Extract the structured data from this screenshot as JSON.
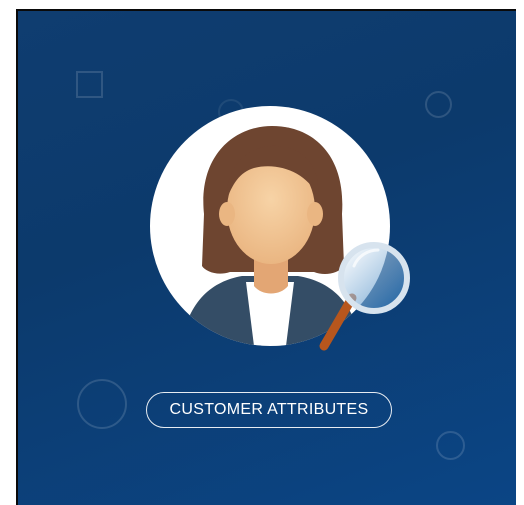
{
  "card": {
    "button_label": "CUSTOMER ATTRIBUTES"
  },
  "illustration": {
    "subject": "woman-avatar",
    "overlay": "magnifying-glass"
  },
  "colors": {
    "background_top": "#0f3d70",
    "background_bottom": "#0b4585",
    "hair": "#6e4530",
    "skin": "#f2c493",
    "jacket": "#344d66",
    "shirt": "#ffffff",
    "magnifier_rim": "#d7e3ee",
    "magnifier_handle": "#b7561d"
  }
}
